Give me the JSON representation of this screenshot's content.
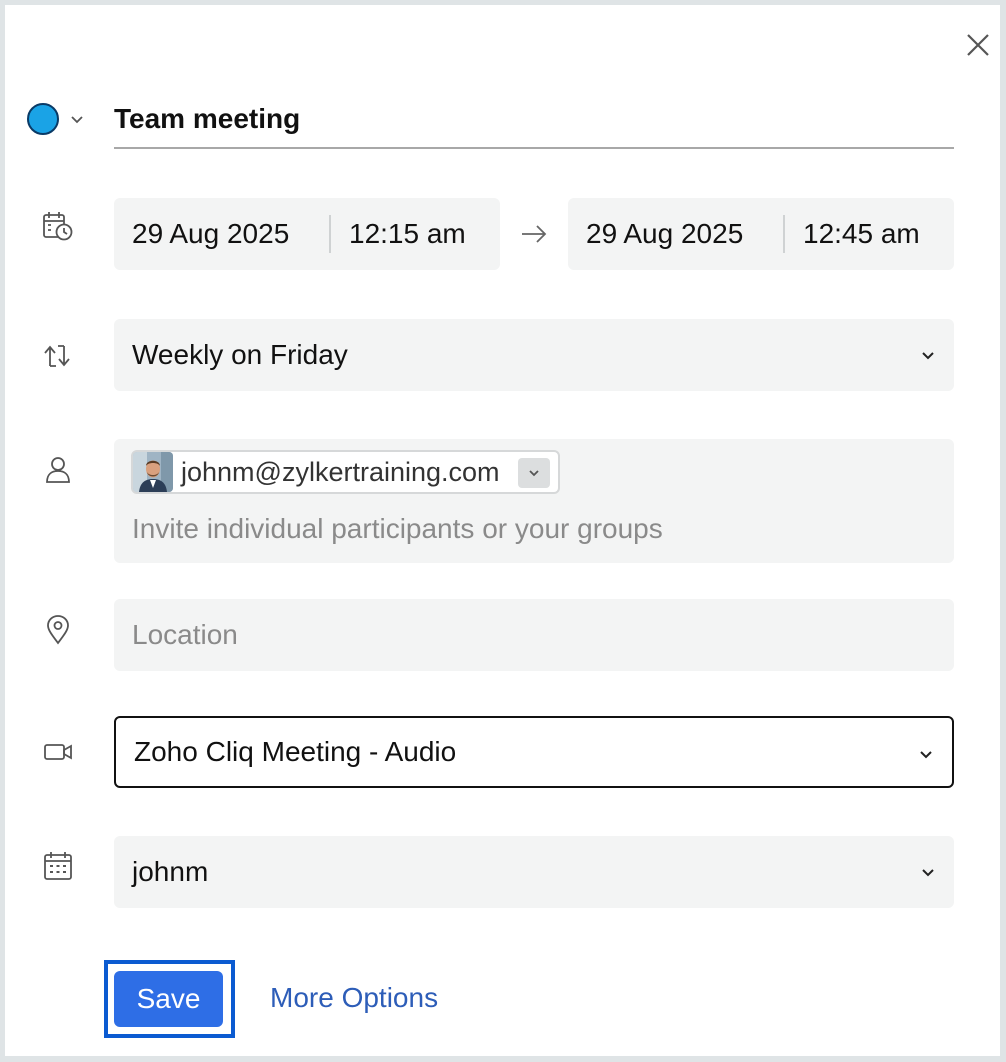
{
  "event": {
    "title": "Team meeting",
    "color": "#1aa3e6"
  },
  "datetime": {
    "start_date": "29 Aug 2025",
    "start_time": "12:15 am",
    "end_date": "29 Aug 2025",
    "end_time": "12:45 am"
  },
  "repeat": {
    "value": "Weekly on Friday"
  },
  "participants": {
    "chip_email": "johnm@zylkertraining.com",
    "placeholder": "Invite individual participants or your groups"
  },
  "location": {
    "placeholder": "Location"
  },
  "conference": {
    "value": "Zoho Cliq Meeting - Audio"
  },
  "calendar": {
    "value": "johnm"
  },
  "actions": {
    "save_label": "Save",
    "more_options_label": "More Options"
  },
  "icons": {
    "close": "close-icon",
    "color_dropdown": "chevron-down-icon",
    "datetime": "calendar-clock-icon",
    "arrow": "arrow-right-icon",
    "repeat": "repeat-icon",
    "participants": "person-icon",
    "location": "location-pin-icon",
    "conference": "video-camera-icon",
    "calendar": "calendar-icon"
  },
  "colors": {
    "accent": "#2e6ee6",
    "link": "#2d5db8",
    "field_bg": "#f3f4f4"
  }
}
